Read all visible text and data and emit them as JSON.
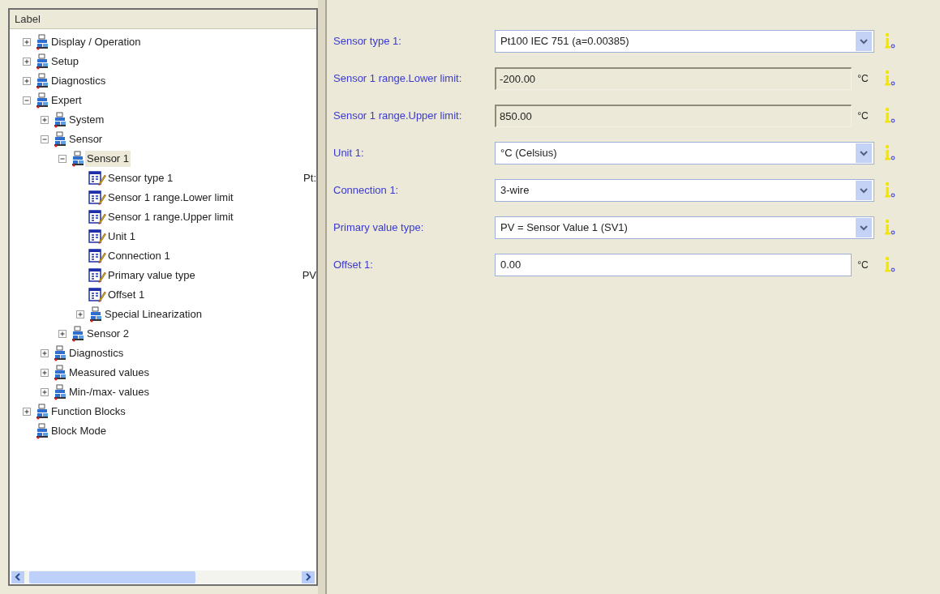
{
  "tree": {
    "header": "Label",
    "items": [
      {
        "label": "Display / Operation",
        "kind": "folder",
        "expanded": false,
        "selected": false
      },
      {
        "label": "Setup",
        "kind": "folder",
        "expanded": false,
        "selected": false
      },
      {
        "label": "Diagnostics",
        "kind": "folder",
        "expanded": false,
        "selected": false
      },
      {
        "label": "Expert",
        "kind": "folder",
        "expanded": true,
        "selected": false,
        "children": [
          {
            "label": "System",
            "kind": "folder",
            "expanded": false,
            "selected": false
          },
          {
            "label": "Sensor",
            "kind": "folder",
            "expanded": true,
            "selected": false,
            "children": [
              {
                "label": "Sensor 1",
                "kind": "folder",
                "expanded": true,
                "selected": true,
                "children": [
                  {
                    "label": "Sensor type 1",
                    "kind": "parameter",
                    "selected": false,
                    "value": "Pt:"
                  },
                  {
                    "label": "Sensor 1 range.Lower limit",
                    "kind": "parameter",
                    "selected": false
                  },
                  {
                    "label": "Sensor 1 range.Upper limit",
                    "kind": "parameter",
                    "selected": false
                  },
                  {
                    "label": "Unit 1",
                    "kind": "parameter",
                    "selected": false
                  },
                  {
                    "label": "Connection 1",
                    "kind": "parameter",
                    "selected": false
                  },
                  {
                    "label": "Primary value type",
                    "kind": "parameter",
                    "selected": false,
                    "value": "PV"
                  },
                  {
                    "label": "Offset 1",
                    "kind": "parameter",
                    "selected": false
                  },
                  {
                    "label": "Special Linearization",
                    "kind": "folder",
                    "expanded": false,
                    "selected": false
                  }
                ]
              },
              {
                "label": "Sensor 2",
                "kind": "folder",
                "expanded": false,
                "selected": false
              }
            ]
          },
          {
            "label": "Diagnostics",
            "kind": "folder",
            "expanded": false,
            "selected": false
          },
          {
            "label": "Measured values",
            "kind": "folder",
            "expanded": false,
            "selected": false
          },
          {
            "label": "Min-/max- values",
            "kind": "folder",
            "expanded": false,
            "selected": false
          }
        ]
      },
      {
        "label": "Function Blocks",
        "kind": "folder",
        "expanded": false,
        "selected": false
      },
      {
        "label": "Block Mode",
        "kind": "leaf",
        "selected": false
      }
    ]
  },
  "fields": [
    {
      "label": "Sensor type 1:",
      "kind": "dropdown",
      "value": "Pt100  IEC 751 (a=0.00385)"
    },
    {
      "label": "Sensor 1 range.Lower limit:",
      "kind": "readonly",
      "value": "-200.00",
      "unit": "°C"
    },
    {
      "label": "Sensor 1 range.Upper limit:",
      "kind": "readonly",
      "value": "850.00",
      "unit": "°C"
    },
    {
      "label": "Unit 1:",
      "kind": "dropdown",
      "value": "°C (Celsius)"
    },
    {
      "label": "Connection 1:",
      "kind": "dropdown",
      "value": "3-wire"
    },
    {
      "label": "Primary value type:",
      "kind": "dropdown",
      "value": "PV = Sensor Value 1 (SV1)"
    },
    {
      "label": "Offset 1:",
      "kind": "text",
      "value": "0.00",
      "unit": "°C"
    }
  ]
}
